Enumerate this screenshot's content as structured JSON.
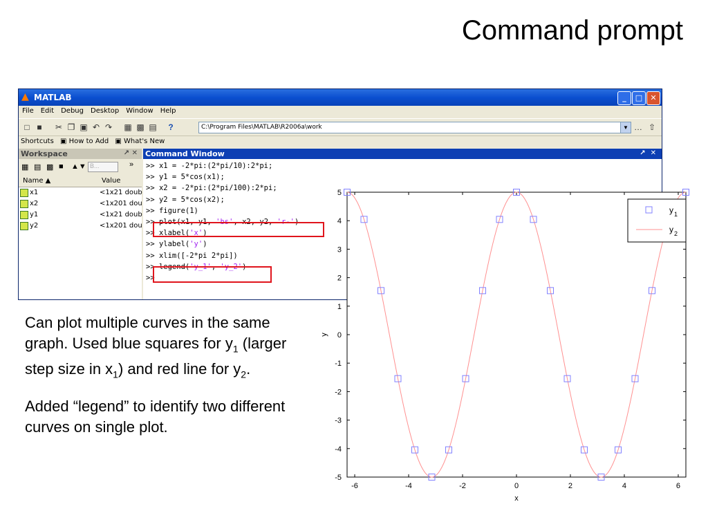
{
  "slide": {
    "title": "Command prompt",
    "caption_1_parts": [
      "Can plot multiple curves in the same graph. Used blue squares for y",
      "1",
      " (larger step size in x",
      "1",
      ") and red line for y",
      "2",
      "."
    ],
    "caption_2": "Added “legend” to identify two different curves on single plot."
  },
  "window": {
    "title": "MATLAB",
    "menu": [
      "File",
      "Edit",
      "Debug",
      "Desktop",
      "Window",
      "Help"
    ],
    "current_directory": "C:\\Program Files\\MATLAB\\R2006a\\work",
    "shortcuts": [
      "Shortcuts",
      "How to Add",
      "What's New"
    ],
    "buttons": {
      "minimize": "_",
      "maximize": "□",
      "close": "✕"
    }
  },
  "workspace": {
    "title": "Workspace",
    "stack_label": "B...",
    "columns": [
      "Name ▲",
      "Value"
    ],
    "rows": [
      {
        "name": "x1",
        "value": "<1x21 doub"
      },
      {
        "name": "x2",
        "value": "<1x201 dou"
      },
      {
        "name": "y1",
        "value": "<1x21 doub"
      },
      {
        "name": "y2",
        "value": "<1x201 dou"
      }
    ]
  },
  "command_window": {
    "title": "Command Window",
    "lines": [
      ">> x1 = -2*pi:(2*pi/10):2*pi;",
      ">> y1 = 5*cos(x1);",
      ">> x2 = -2*pi:(2*pi/100):2*pi;",
      ">> y2 = 5*cos(x2);",
      ">> figure(1)",
      ">> plot(x1, y1, 'bs', x2, y2, 'r-')",
      ">> xlabel('x')",
      ">> ylabel('y')",
      ">> xlim([-2*pi 2*pi])",
      ">> legend('y_1', 'y_2')",
      ">>"
    ]
  },
  "chart_data": {
    "type": "line",
    "xlabel": "x",
    "ylabel": "y",
    "xlim": [
      -6.2832,
      6.2832
    ],
    "ylim": [
      -5,
      5
    ],
    "xticks": [
      -6,
      -4,
      -2,
      0,
      2,
      4,
      6
    ],
    "yticks": [
      -5,
      -4,
      -3,
      -2,
      -1,
      0,
      1,
      2,
      3,
      4,
      5
    ],
    "grid": false,
    "legend_position": "top-right",
    "series": [
      {
        "name": "y1",
        "marker": "square",
        "color": "#8080ff",
        "x": [
          -6.2832,
          -5.6549,
          -5.0265,
          -4.3982,
          -3.7699,
          -3.1416,
          -2.5133,
          -1.885,
          -1.2566,
          -0.6283,
          0,
          0.6283,
          1.2566,
          1.885,
          2.5133,
          3.1416,
          3.7699,
          4.3982,
          5.0265,
          5.6549,
          6.2832
        ],
        "y": [
          5,
          4.0451,
          1.5451,
          -1.5451,
          -4.0451,
          -5,
          -4.0451,
          -1.5451,
          1.5451,
          4.0451,
          5,
          4.0451,
          1.5451,
          -1.5451,
          -4.0451,
          -5,
          -4.0451,
          -1.5451,
          1.5451,
          4.0451,
          5
        ]
      },
      {
        "name": "y2",
        "function": "5*cos(x)",
        "x_start": -6.2832,
        "x_end": 6.2832,
        "points": 201,
        "color": "#ff9090"
      }
    ]
  },
  "colors": {
    "highlight_box": "#e0141c",
    "string_literal": "#a020f0",
    "titlebar": "#0b4fd0"
  }
}
